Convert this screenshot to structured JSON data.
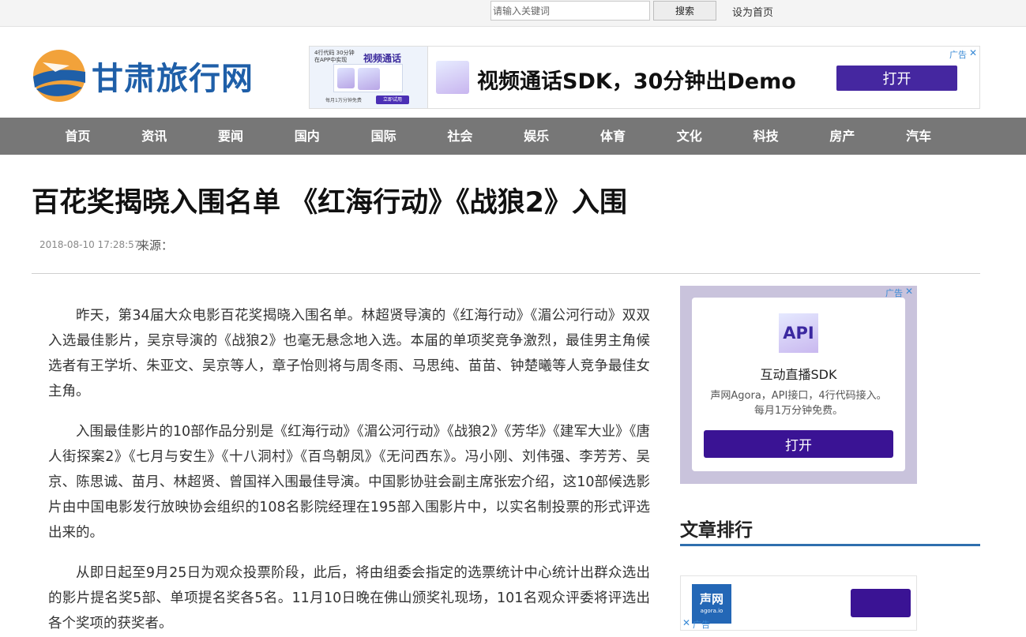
{
  "topbar": {
    "search_placeholder": "请输入关键词",
    "search_button": "搜索",
    "set_homepage": "设为首页"
  },
  "header": {
    "logo_text": "甘肃旅行网"
  },
  "banner_ad": {
    "thumb_small_text": "4行代码 30分钟 在APP中实现",
    "thumb_title": "视频通话",
    "thumb_footer": "每月1万分钟免费",
    "thumb_button": "立即试用",
    "text": "视频通话SDK，30分钟出Demo",
    "button": "打开",
    "ad_label": "广告",
    "close": "✕"
  },
  "nav": {
    "items": [
      "首页",
      "资讯",
      "要闻",
      "国内",
      "国际",
      "社会",
      "娱乐",
      "体育",
      "文化",
      "科技",
      "房产",
      "汽车"
    ]
  },
  "article": {
    "title": "百花奖揭晓入围名单 《红海行动》《战狼2》入围",
    "date": "2018-08-10 17:28:57",
    "source_label": "来源：",
    "paragraphs": [
      "昨天，第34届大众电影百花奖揭晓入围名单。林超贤导演的《红海行动》《湄公河行动》双双入选最佳影片，吴京导演的《战狼2》也毫无悬念地入选。本届的单项奖竞争激烈，最佳男主角候选者有王学圻、朱亚文、吴京等人，章子怡则将与周冬雨、马思纯、苗苗、钟楚曦等人竞争最佳女主角。",
      "入围最佳影片的10部作品分别是《红海行动》《湄公河行动》《战狼2》《芳华》《建军大业》《唐人街探案2》《七月与安生》《十八洞村》《百鸟朝凤》《无问西东》。冯小刚、刘伟强、李芳芳、吴京、陈思诚、苗月、林超贤、曾国祥入围最佳导演。中国影协驻会副主席张宏介绍，这10部候选影片由中国电影发行放映协会组织的108名影院经理在195部入围影片中，以实名制投票的形式评选出来的。",
      "从即日起至9月25日为观众投票阶段，此后，将由组委会指定的选票统计中心统计出群众选出的影片提名奖5部、单项提名奖各5名。11月10日晚在佛山颁奖礼现场，101名观众评委将评选出各个奖项的获奖者。"
    ]
  },
  "side_ad": {
    "icon_text": "API",
    "title": "互动直播SDK",
    "desc_line1": "声网Agora，API接口，4行代码接入。",
    "desc_line2": "每月1万分钟免费。",
    "button": "打开",
    "ad_label": "广告",
    "close": "✕"
  },
  "ranking": {
    "title": "文章排行"
  },
  "bottom_ad": {
    "logo_line1": "声网",
    "logo_line2": "agora.io",
    "ad_label": "广告",
    "close": "✕"
  },
  "colors": {
    "nav_bg": "#777777",
    "brand_blue": "#1f5fa8",
    "ad_purple": "#4527a0",
    "ranking_line": "#2f6fae"
  }
}
